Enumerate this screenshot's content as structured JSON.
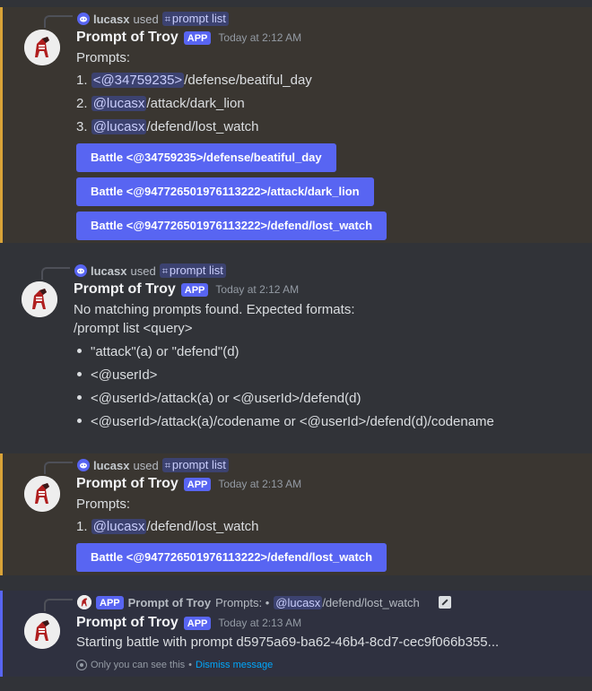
{
  "messages": [
    {
      "reply": {
        "user": "lucasx",
        "verb": "used",
        "command": "prompt list"
      },
      "bot_name": "Prompt of Troy",
      "app_tag": "APP",
      "time": "Today at 2:12 AM",
      "lines": [
        {
          "text": "Prompts:"
        },
        {
          "num": "1.",
          "mention": "<@34759235>",
          "rest": "/defense/beatiful_day"
        },
        {
          "num": "2.",
          "mention": "@lucasx",
          "rest": "/attack/dark_lion"
        },
        {
          "num": "3.",
          "mention": "@lucasx",
          "rest": "/defend/lost_watch"
        }
      ],
      "buttons": [
        "Battle <@34759235>/defense/beatiful_day",
        "Battle <@947726501976113222>/attack/dark_lion",
        "Battle <@947726501976113222>/defend/lost_watch"
      ]
    },
    {
      "reply": {
        "user": "lucasx",
        "verb": "used",
        "command": "prompt list"
      },
      "bot_name": "Prompt of Troy",
      "app_tag": "APP",
      "time": "Today at 2:12 AM",
      "lines": [
        "No matching prompts found. Expected formats:",
        "/prompt list <query>"
      ],
      "bullets": [
        "\"attack\"(a) or \"defend\"(d)",
        "<@userId>",
        "<@userId>/attack(a) or <@userId>/defend(d)",
        "<@userId>/attack(a)/codename or <@userId>/defend(d)/codename"
      ]
    },
    {
      "reply": {
        "user": "lucasx",
        "verb": "used",
        "command": "prompt list"
      },
      "bot_name": "Prompt of Troy",
      "app_tag": "APP",
      "time": "Today at 2:13 AM",
      "lines": [
        {
          "text": "Prompts:"
        },
        {
          "num": "1.",
          "mention": "@lucasx",
          "rest": "/defend/lost_watch"
        }
      ],
      "buttons": [
        "Battle <@947726501976113222>/defend/lost_watch"
      ]
    },
    {
      "reply": {
        "app_tag": "APP",
        "bot_name": "Prompt of Troy",
        "prefix": "Prompts: •",
        "mention": "@lucasx",
        "rest": "/defend/lost_watch"
      },
      "bot_name": "Prompt of Troy",
      "app_tag": "APP",
      "time": "Today at 2:13 AM",
      "text": "Starting battle with prompt d5975a69-ba62-46b4-8cd7-cec9f066b355...",
      "footer": {
        "note": "Only you can see this",
        "sep": "•",
        "dismiss": "Dismiss message"
      }
    }
  ],
  "colors": {
    "background": "#313338",
    "highlight": "#3a3631",
    "highlight_border": "#d9a338",
    "ephemeral_border": "#5865f2",
    "button": "#5865f2",
    "mention_bg": "#3c4270",
    "link": "#00a8fc"
  },
  "icons": {
    "discord": "discord-logo-icon",
    "command": "slash-command-icon",
    "edit": "edit-icon",
    "eye": "eye-icon"
  }
}
